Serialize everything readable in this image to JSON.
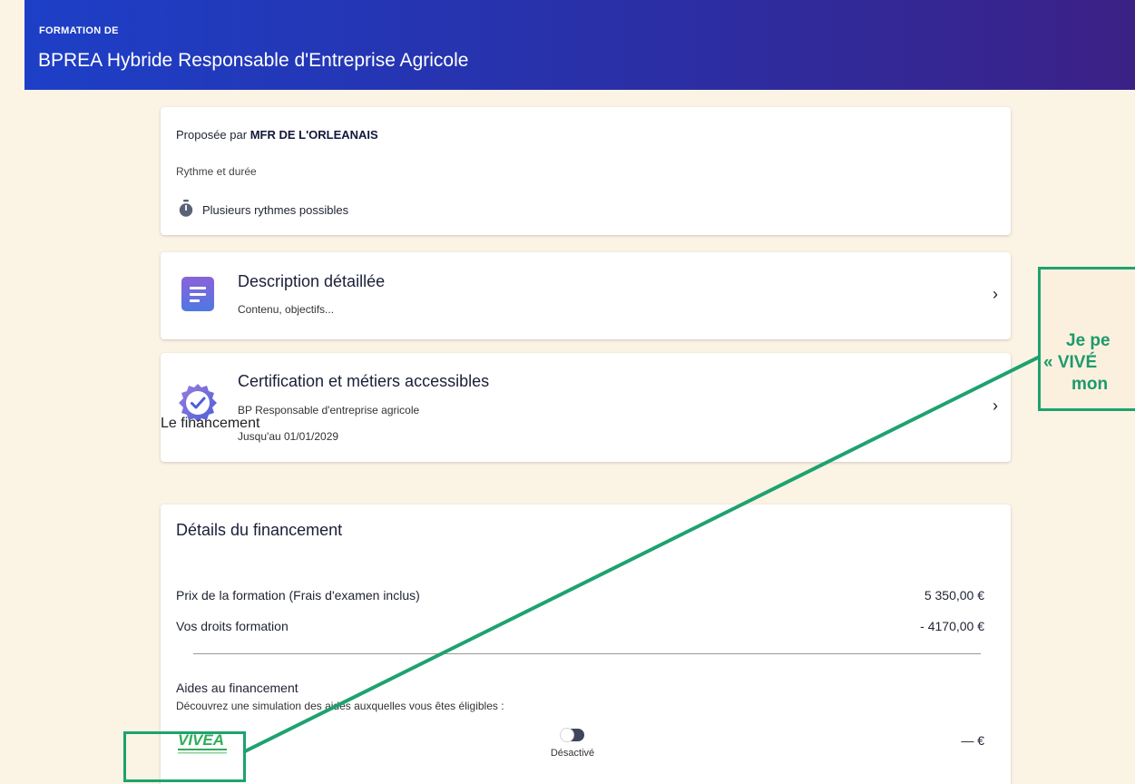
{
  "header": {
    "kicker": "FORMATION DE",
    "title": "BPREA Hybride Responsable d'Entreprise Agricole",
    "gradient_start": "#1d3fc7",
    "gradient_end": "#3b2186"
  },
  "provider": {
    "prefix": "Proposée par",
    "name": "MFR DE L'ORLEANAIS",
    "rythme_label": "Rythme et durée",
    "rythme_value": "Plusieurs rythmes possibles",
    "rythme_icon": "stopwatch-icon"
  },
  "description_card": {
    "title": "Description détaillée",
    "subtitle": "Contenu, objectifs...",
    "icon": "document-icon",
    "chevron": "›"
  },
  "certification_card": {
    "title": "Certification et métiers accessibles",
    "subtitle": "BP Responsable d'entreprise agricole",
    "validity": "Jusqu'au 01/01/2029",
    "icon": "certified-badge-icon",
    "chevron": "›"
  },
  "financing": {
    "section_title": "Le financement",
    "details_title": "Détails du financement",
    "price_label": "Prix de la formation (Frais d'examen inclus)",
    "price_value": "5 350,00 €",
    "rights_label": "Vos droits formation",
    "rights_value": "- 4170,00 €",
    "aides_title": "Aides au financement",
    "aides_subtitle": "Découvrez une simulation des aides auxquelles vous êtes éligibles :",
    "vivea_logo": "VIVÉA",
    "toggle_state": "Désactivé",
    "amount": "— €"
  },
  "callout": {
    "line1": "Je pe",
    "line2": "« VIVÉ",
    "line3": "mon",
    "accent_color": "#1ea26f"
  }
}
